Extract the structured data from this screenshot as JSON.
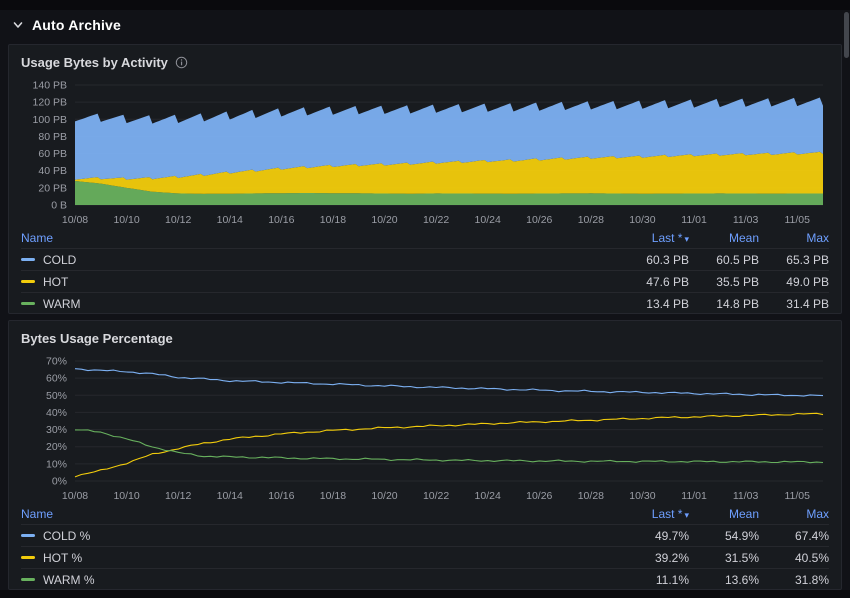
{
  "page": {
    "section_title": "Auto Archive"
  },
  "panels": [
    {
      "title": "Usage Bytes by Activity",
      "info_icon": "i",
      "table": {
        "headers": {
          "name": "Name",
          "last": "Last *",
          "mean": "Mean",
          "max": "Max"
        },
        "rows": [
          {
            "name": "COLD",
            "color": "#7cb0f2",
            "last": "60.3 PB",
            "mean": "60.5 PB",
            "max": "65.3 PB"
          },
          {
            "name": "HOT",
            "color": "#f2cc0c",
            "last": "47.6 PB",
            "mean": "35.5 PB",
            "max": "49.0 PB"
          },
          {
            "name": "WARM",
            "color": "#68b15e",
            "last": "13.4 PB",
            "mean": "14.8 PB",
            "max": "31.4 PB"
          }
        ]
      }
    },
    {
      "title": "Bytes Usage Percentage",
      "table": {
        "headers": {
          "name": "Name",
          "last": "Last *",
          "mean": "Mean",
          "max": "Max"
        },
        "rows": [
          {
            "name": "COLD %",
            "color": "#7cb0f2",
            "last": "49.7%",
            "mean": "54.9%",
            "max": "67.4%"
          },
          {
            "name": "HOT %",
            "color": "#f2cc0c",
            "last": "39.2%",
            "mean": "31.5%",
            "max": "40.5%"
          },
          {
            "name": "WARM %",
            "color": "#68b15e",
            "last": "11.1%",
            "mean": "13.6%",
            "max": "31.8%"
          }
        ]
      }
    }
  ],
  "chart_data": [
    {
      "type": "area",
      "stacked": true,
      "title": "Usage Bytes by Activity",
      "unit": "PB",
      "ylim": [
        0,
        140
      ],
      "days": 29,
      "y_tick_labels": [
        "0 B",
        "20 PB",
        "40 PB",
        "60 PB",
        "80 PB",
        "100 PB",
        "120 PB",
        "140 PB"
      ],
      "x_tick_labels": [
        "10/08",
        "10/10",
        "10/12",
        "10/14",
        "10/16",
        "10/18",
        "10/20",
        "10/22",
        "10/24",
        "10/26",
        "10/28",
        "10/30",
        "11/01",
        "11/03",
        "11/05"
      ],
      "series": [
        {
          "name": "WARM",
          "color": "#68b15e",
          "values": [
            28,
            25,
            20,
            15.5,
            13.5,
            13,
            13.2,
            13.5,
            13.8,
            14,
            13.8,
            13.6,
            13.4,
            13.2,
            13.5,
            13.4,
            13.3,
            13.2,
            13.4,
            13.5,
            13.6,
            13.4,
            13.2,
            13.3,
            13.4,
            13.5,
            13.4,
            13.3,
            13.4,
            13.4
          ]
        },
        {
          "name": "HOT",
          "color": "#f2cc0c",
          "sawtooth": 3,
          "values": [
            3,
            6.5,
            11,
            16,
            19.5,
            22.5,
            25,
            27,
            29,
            30.5,
            32,
            33.2,
            34.2,
            35.2,
            36.2,
            37.2,
            38.2,
            39,
            40,
            41,
            41.8,
            42.6,
            43.4,
            44.2,
            44.9,
            45.5,
            46.1,
            46.6,
            47.1,
            47.6
          ]
        },
        {
          "name": "COLD",
          "color": "#7cb0f2",
          "sawtooth": 8,
          "values": [
            72,
            71,
            70,
            69,
            68.2,
            67.5,
            67,
            66.5,
            66,
            65.5,
            65,
            64.6,
            64.2,
            63.8,
            63.4,
            63,
            62.7,
            62.4,
            62.1,
            61.8,
            61.5,
            61.3,
            61.1,
            60.9,
            60.8,
            60.7,
            60.6,
            60.5,
            60.4,
            60.3
          ]
        }
      ]
    },
    {
      "type": "line",
      "title": "Bytes Usage Percentage",
      "unit": "%",
      "ylim": [
        0,
        70
      ],
      "days": 29,
      "noise": 0.6,
      "y_tick_labels": [
        "0%",
        "10%",
        "20%",
        "30%",
        "40%",
        "50%",
        "60%",
        "70%"
      ],
      "x_tick_labels": [
        "10/08",
        "10/10",
        "10/12",
        "10/14",
        "10/16",
        "10/18",
        "10/20",
        "10/22",
        "10/24",
        "10/26",
        "10/28",
        "10/30",
        "11/01",
        "11/03",
        "11/05"
      ],
      "series": [
        {
          "name": "COLD %",
          "color": "#7cb0f2",
          "values": [
            65.5,
            64.5,
            63.8,
            62.5,
            60.5,
            59.5,
            58.5,
            58,
            57.5,
            57,
            56.5,
            56,
            55.5,
            55,
            54.6,
            54.2,
            53.8,
            53.4,
            53,
            52.6,
            52.3,
            52,
            51.7,
            51.4,
            51.1,
            50.8,
            50.5,
            50.2,
            50,
            49.7
          ]
        },
        {
          "name": "HOT %",
          "color": "#f2cc0c",
          "values": [
            3,
            6,
            10.5,
            15.5,
            19,
            22,
            24.5,
            26,
            27.5,
            28.5,
            29.5,
            30.3,
            31,
            31.6,
            32.2,
            32.8,
            33.4,
            34,
            34.5,
            35,
            35.5,
            36,
            36.5,
            37,
            37.4,
            37.8,
            38.2,
            38.6,
            39,
            39.2
          ]
        },
        {
          "name": "WARM %",
          "color": "#68b15e",
          "values": [
            30,
            28.5,
            24.5,
            20,
            16.5,
            14.5,
            14,
            13.8,
            13.5,
            13.2,
            13,
            12.8,
            12.6,
            12.4,
            12.2,
            12,
            11.9,
            11.8,
            11.7,
            11.6,
            11.5,
            11.5,
            11.4,
            11.4,
            11.3,
            11.3,
            11.2,
            11.2,
            11.1,
            11.1
          ]
        }
      ]
    }
  ]
}
